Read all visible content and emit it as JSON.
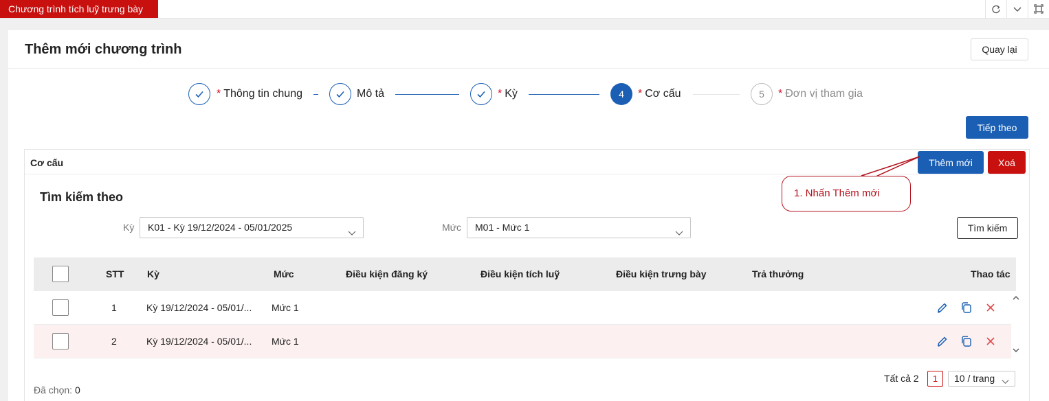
{
  "app_tab": {
    "label": "Chương trình tích luỹ trưng bày"
  },
  "header": {
    "title": "Thêm mới chương trình",
    "back_label": "Quay lại"
  },
  "steps": [
    {
      "label": "Thông tin chung",
      "required": true,
      "status": "done"
    },
    {
      "label": "Mô tả",
      "required": false,
      "status": "done"
    },
    {
      "label": "Kỳ",
      "required": true,
      "status": "done"
    },
    {
      "number": "4",
      "label": "Cơ cấu",
      "required": true,
      "status": "active"
    },
    {
      "number": "5",
      "label": "Đơn vị tham gia",
      "required": true,
      "status": "pending"
    }
  ],
  "step_required_mark": "*",
  "next_label": "Tiếp theo",
  "section": {
    "title": "Cơ cấu",
    "add_label": "Thêm mới",
    "delete_label": "Xoá"
  },
  "search": {
    "title": "Tìm kiếm theo",
    "period_label": "Kỳ",
    "period_value": "K01 - Kỳ 19/12/2024 - 05/01/2025",
    "level_label": "Mức",
    "level_value": "M01 - Mức 1",
    "button_label": "Tìm kiếm"
  },
  "table": {
    "columns": [
      "STT",
      "Kỳ",
      "Mức",
      "Điều kiện đăng ký",
      "Điều kiện tích luỹ",
      "Điều kiện trưng bày",
      "Trả thưởng",
      "Thao tác"
    ],
    "rows": [
      {
        "stt": "1",
        "period": "Kỳ 19/12/2024 - 05/01/...",
        "level": "Mức 1"
      },
      {
        "stt": "2",
        "period": "Kỳ 19/12/2024 - 05/01/...",
        "level": "Mức 1"
      }
    ]
  },
  "pagination": {
    "total_text": "Tất cả 2",
    "current_page": "1",
    "page_size": "10 / trang"
  },
  "selection": {
    "label": "Đã chọn:",
    "count": "0"
  },
  "annotation": {
    "text": "1. Nhấn Thêm mới"
  },
  "colors": {
    "primary": "#1a5fb4",
    "danger": "#c8100f",
    "annotation": "#b3121d"
  }
}
